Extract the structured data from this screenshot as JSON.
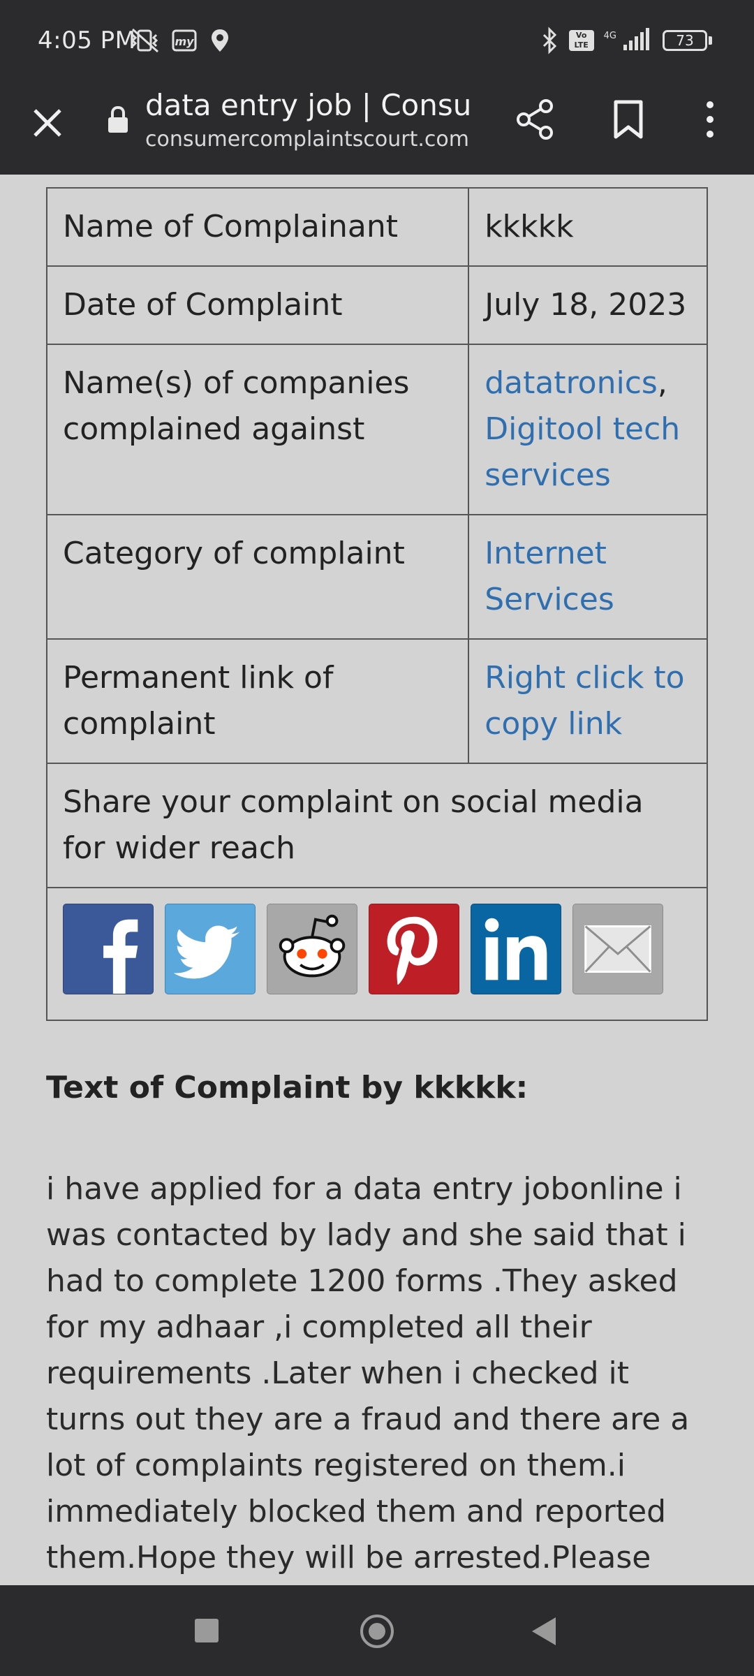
{
  "status_bar": {
    "time": "4:05 PM",
    "battery": "73",
    "network": "4G",
    "icons": [
      "vibrate-off-icon",
      "myjio-icon",
      "location-icon",
      "bluetooth-icon",
      "volte-icon",
      "signal-icon",
      "battery-icon"
    ]
  },
  "toolbar": {
    "title": "data entry job | Consu…",
    "url": "consumercomplaintscourt.com",
    "icons": [
      "close-icon",
      "lock-icon",
      "share-icon",
      "bookmark-icon",
      "more-vert-icon"
    ]
  },
  "complaint_table": {
    "rows": [
      {
        "label": "Name of Complainant",
        "value": "kkkkk"
      },
      {
        "label": "Date of Complaint",
        "value": "July 18, 2023"
      },
      {
        "label": "Name(s) of companies complained against",
        "links": [
          "datatronics",
          "Digitool tech services"
        ],
        "separator": ","
      },
      {
        "label": "Category of complaint",
        "link": "Internet Services"
      },
      {
        "label": "Permanent link of complaint",
        "link": "Right click to copy link"
      }
    ],
    "share_text": "Share your complaint on social media for wider reach",
    "social_buttons": [
      "facebook",
      "twitter",
      "reddit",
      "pinterest",
      "linkedin",
      "email"
    ],
    "colors": {
      "facebook": "#3b5998",
      "twitter": "#5aa8dc",
      "reddit": "#a8a8a8",
      "pinterest": "#be1f27",
      "linkedin": "#0a66a3",
      "email": "#a8a8a8",
      "link": "#2f6fb0"
    }
  },
  "complaint_heading": "Text of Complaint by kkkkk:",
  "complaint_text": "i have applied for a data entry jobonline i was contacted by lady and she said that i had to complete 1200 forms .They asked for my adhaar ,i completed all their requirements .Later when i checked it turns out they are a fraud and there are a lot of complaints registered on them.i immediately blocked them and reported them.Hope they will be arrested.Please take carew of this fraud",
  "nav_bar": {
    "buttons": [
      "recent-apps",
      "home",
      "back"
    ]
  }
}
